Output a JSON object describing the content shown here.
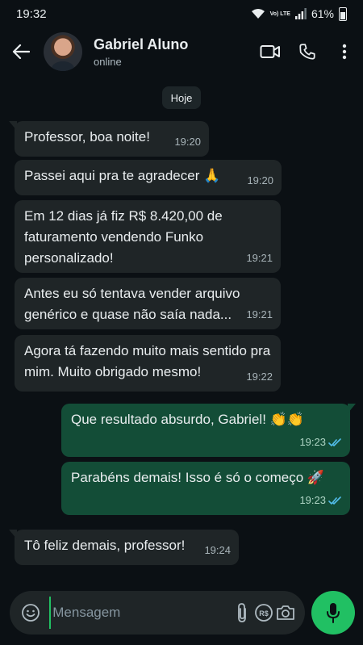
{
  "status_bar": {
    "time": "19:32",
    "network": "Vo) LTE",
    "battery": "61%"
  },
  "header": {
    "contact_name": "Gabriel Aluno",
    "contact_status": "online"
  },
  "chat": {
    "date_chip": "Hoje",
    "messages": [
      {
        "text": "Professor, boa noite!",
        "time": "19:20",
        "direction": "in"
      },
      {
        "text": "Passei aqui pra te agradecer 🙏",
        "time": "19:20",
        "direction": "in"
      },
      {
        "text": "Em 12 dias já fiz R$ 8.420,00 de faturamento vendendo Funko personalizado!",
        "time": "19:21",
        "direction": "in"
      },
      {
        "text": "Antes eu só tentava vender arquivo genérico e quase não saía nada...",
        "time": "19:21",
        "direction": "in"
      },
      {
        "text": "Agora tá fazendo muito mais sentido pra mim. Muito obrigado mesmo!",
        "time": "19:22",
        "direction": "in"
      },
      {
        "text": "Que resultado absurdo, Gabriel! 👏👏",
        "time": "19:23",
        "direction": "out",
        "status": "read"
      },
      {
        "text": "Parabéns demais! Isso é só o começo 🚀",
        "time": "19:23",
        "direction": "out",
        "status": "read"
      },
      {
        "text": "Tô feliz demais, professor!",
        "time": "19:24",
        "direction": "in"
      }
    ]
  },
  "input": {
    "placeholder": "Mensagem"
  },
  "colors": {
    "background": "#0b1014",
    "incoming_bubble": "#1f2527",
    "outgoing_bubble": "#134d37",
    "accent": "#21c063",
    "read_ticks": "#53bdeb"
  }
}
